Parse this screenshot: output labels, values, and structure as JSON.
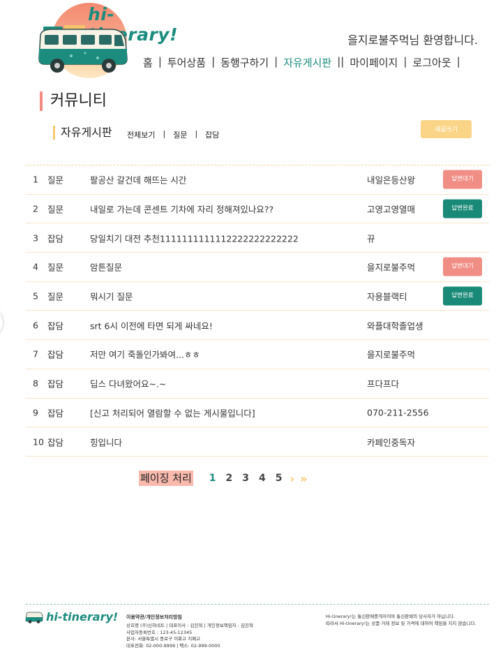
{
  "brand": {
    "logo_text": "hi-tinerary!",
    "accent_color": "#1c8c7e"
  },
  "header": {
    "welcome": "을지로불주먹님 환영합니다.",
    "nav": [
      {
        "label": "홈"
      },
      {
        "label": "투어상품"
      },
      {
        "label": "동행구하기"
      },
      {
        "label": "자유게시판",
        "active": true
      },
      {
        "label": "마이페이지"
      },
      {
        "label": "로그아웃"
      }
    ]
  },
  "page": {
    "title": "커뮤니티",
    "board_title": "자유게시판",
    "tabs": [
      "전체보기",
      "질문",
      "잡담"
    ],
    "write_button": "새글쓰기"
  },
  "posts": [
    {
      "no": "1",
      "category": "질문",
      "title": "팔공산 갈건데 해뜨는 시간",
      "author": "내일은등산왕",
      "badge": "답변대기",
      "badge_state": "waiting"
    },
    {
      "no": "2",
      "category": "질문",
      "title": "내일로 가는데 콘센트 기차에 자리 정해져있나요??",
      "author": "고영고영열매",
      "badge": "답변완료",
      "badge_state": "done"
    },
    {
      "no": "3",
      "category": "잡담",
      "title": "당일치기 대전 추천1111111111112222222222222",
      "author": "뀨",
      "badge": "",
      "badge_state": ""
    },
    {
      "no": "4",
      "category": "질문",
      "title": "암튼질문",
      "author": "을지로불주먹",
      "badge": "답변대기",
      "badge_state": "waiting"
    },
    {
      "no": "5",
      "category": "질문",
      "title": "뭐시기 질문",
      "author": "자용블랙티",
      "badge": "답변완료",
      "badge_state": "done"
    },
    {
      "no": "6",
      "category": "잡담",
      "title": "srt 6시 이전에 타면 되게 싸네요!",
      "author": "와플대학졸업생",
      "badge": "",
      "badge_state": ""
    },
    {
      "no": "7",
      "category": "잡담",
      "title": "저만 여기 죽돌인가봐여...ㅎㅎ",
      "author": "을지로불주먹",
      "badge": "",
      "badge_state": ""
    },
    {
      "no": "8",
      "category": "잡담",
      "title": "딥스 다녀왔어요~.~",
      "author": "프다프다",
      "badge": "",
      "badge_state": ""
    },
    {
      "no": "9",
      "category": "잡담",
      "title": "[신고 처리되어 열람할 수 없는 게시물입니다]",
      "author": "070-211-2556",
      "badge": "",
      "badge_state": ""
    },
    {
      "no": "10",
      "category": "잡담",
      "title": "힝입니다",
      "author": "카페인중독자",
      "badge": "",
      "badge_state": ""
    }
  ],
  "pagination": {
    "label": "페이징 처리",
    "pages": [
      "1",
      "2",
      "3",
      "4",
      "5"
    ],
    "current": "1",
    "next": "›",
    "last": "»"
  },
  "footer": {
    "logo_text": "hi-tinerary!",
    "policy": "이용약관/개인정보처리방침",
    "lines": [
      "상호명 (주)신하네트  |  대표이사 : 김진혁  |  개인정보책임자 : 김진혁",
      "사업자등록번호 : 123-45-12345",
      "본사: 서울특별시 중로구 이화고 지페고",
      "대표전화: 02-000-9999 | 팩스: 02-999-0000"
    ],
    "notice": [
      "Hi-tinerary!는 통신판매중개자이며 통신판매의 당사자가 아닙니다.",
      "따라서 Hi-tinerary!는 상품·거래 정보 및 가격에 대하여 책임을 지지 않습니다."
    ]
  }
}
